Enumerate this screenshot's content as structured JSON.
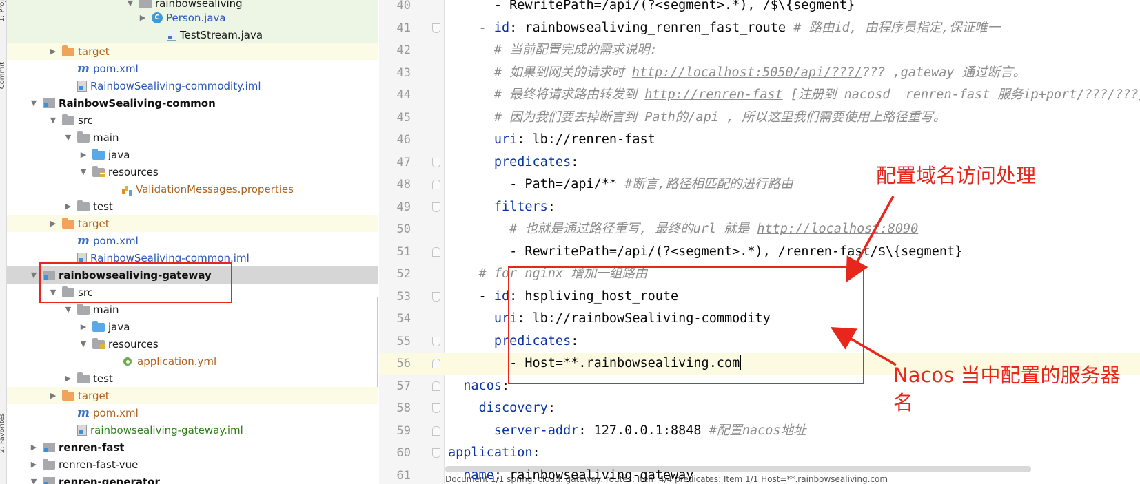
{
  "toolstrip": {
    "labels": [
      "1: Proj",
      "Commit",
      "2: Favorites"
    ]
  },
  "tree": {
    "rows": [
      {
        "label": "rainbowsealiving",
        "style": "t-black",
        "icon": "package",
        "arrow": "down",
        "hl": "hl-green"
      },
      {
        "label": "Person.java",
        "style": "t-blue",
        "icon": "class-c",
        "arrow": "right",
        "hl": "hl-green"
      },
      {
        "label": "TestStream.java",
        "style": "t-black",
        "icon": "file-java",
        "arrow": "none",
        "hl": "hl-green"
      },
      {
        "label": "target",
        "style": "t-orange",
        "icon": "folder-orange",
        "arrow": "right",
        "hl": "hl-yellow"
      },
      {
        "label": "pom.xml",
        "style": "t-blue",
        "icon": "maven",
        "arrow": "none",
        "hl": ""
      },
      {
        "label": "RainbowSealiving-commodity.iml",
        "style": "t-blue",
        "icon": "iml",
        "arrow": "none",
        "hl": ""
      },
      {
        "label": "RainbowSealiving-common",
        "style": "t-bold",
        "icon": "module",
        "arrow": "down",
        "hl": ""
      },
      {
        "label": "src",
        "style": "t-black",
        "icon": "folder",
        "arrow": "down",
        "hl": ""
      },
      {
        "label": "main",
        "style": "t-black",
        "icon": "folder",
        "arrow": "down",
        "hl": ""
      },
      {
        "label": "java",
        "style": "t-black",
        "icon": "folder-blue",
        "arrow": "right",
        "hl": ""
      },
      {
        "label": "resources",
        "style": "t-black",
        "icon": "folder-res",
        "arrow": "down",
        "hl": ""
      },
      {
        "label": "ValidationMessages.properties",
        "style": "t-orange",
        "icon": "props",
        "arrow": "none",
        "hl": ""
      },
      {
        "label": "test",
        "style": "t-black",
        "icon": "folder",
        "arrow": "right",
        "hl": ""
      },
      {
        "label": "target",
        "style": "t-orange",
        "icon": "folder-orange",
        "arrow": "right",
        "hl": "hl-yellow"
      },
      {
        "label": "pom.xml",
        "style": "t-blue",
        "icon": "maven",
        "arrow": "none",
        "hl": ""
      },
      {
        "label": "RainbowSealiving-common.iml",
        "style": "t-blue",
        "icon": "iml",
        "arrow": "none",
        "hl": ""
      },
      {
        "label": "rainbowsealiving-gateway",
        "style": "t-bold",
        "icon": "module",
        "arrow": "down",
        "hl": "hl-gray"
      },
      {
        "label": "src",
        "style": "t-black",
        "icon": "folder",
        "arrow": "down",
        "hl": ""
      },
      {
        "label": "main",
        "style": "t-black",
        "icon": "folder",
        "arrow": "down",
        "hl": ""
      },
      {
        "label": "java",
        "style": "t-black",
        "icon": "folder-blue",
        "arrow": "right",
        "hl": ""
      },
      {
        "label": "resources",
        "style": "t-black",
        "icon": "folder-res",
        "arrow": "down",
        "hl": ""
      },
      {
        "label": "application.yml",
        "style": "t-orange",
        "icon": "yml",
        "arrow": "none",
        "hl": ""
      },
      {
        "label": "test",
        "style": "t-black",
        "icon": "folder",
        "arrow": "right",
        "hl": ""
      },
      {
        "label": "target",
        "style": "t-orange",
        "icon": "folder-orange",
        "arrow": "right",
        "hl": "hl-yellow"
      },
      {
        "label": "pom.xml",
        "style": "t-orange",
        "icon": "maven",
        "arrow": "none",
        "hl": ""
      },
      {
        "label": "rainbowsealiving-gateway.iml",
        "style": "t-green",
        "icon": "iml",
        "arrow": "none",
        "hl": ""
      },
      {
        "label": "renren-fast",
        "style": "t-bold",
        "icon": "module",
        "arrow": "right",
        "hl": ""
      },
      {
        "label": "renren-fast-vue",
        "style": "t-black",
        "icon": "folder",
        "arrow": "right",
        "hl": ""
      },
      {
        "label": "renren-generator",
        "style": "t-bold",
        "icon": "module",
        "arrow": "down",
        "hl": ""
      }
    ]
  },
  "editor": {
    "lines": [
      {
        "n": "40",
        "fold": "none",
        "segs": [
          [
            "",
            "      - RewritePath=/api/(?<segment>.*), /$\\{segment}"
          ]
        ]
      },
      {
        "n": "41",
        "fold": "down",
        "segs": [
          [
            "",
            "    - "
          ],
          [
            "k",
            "id"
          ],
          [
            "",
            ": rainbowsealiving_renren_fast_route "
          ],
          [
            "cm",
            "# 路由id, 由程序员指定,保证唯一"
          ]
        ]
      },
      {
        "n": "42",
        "fold": "none",
        "segs": [
          [
            "cm",
            "      # 当前配置完成的需求说明:"
          ]
        ]
      },
      {
        "n": "43",
        "fold": "none",
        "segs": [
          [
            "cm",
            "      # 如果到网关的请求时 "
          ],
          [
            "cm u",
            "http://localhost:5050/api/???/"
          ],
          [
            "cm",
            "??? ,gateway 通过断言。"
          ]
        ]
      },
      {
        "n": "44",
        "fold": "none",
        "segs": [
          [
            "cm",
            "      # 最终将请求路由转发到 "
          ],
          [
            "cm u",
            "http://renren-fast"
          ],
          [
            "cm",
            " [注册到 nacosd  renren-fast 服务ip+port/???/???]"
          ]
        ]
      },
      {
        "n": "45",
        "fold": "none",
        "segs": [
          [
            "cm",
            "      # 因为我们要去掉断言到 Path的/api , 所以这里我们需要使用上路径重写。"
          ]
        ]
      },
      {
        "n": "46",
        "fold": "none",
        "segs": [
          [
            "",
            "      "
          ],
          [
            "k",
            "uri"
          ],
          [
            "",
            ": lb://renren-fast"
          ]
        ]
      },
      {
        "n": "47",
        "fold": "down",
        "segs": [
          [
            "",
            "      "
          ],
          [
            "k",
            "predicates"
          ],
          [
            "",
            ":"
          ]
        ]
      },
      {
        "n": "48",
        "fold": "up",
        "segs": [
          [
            "",
            "        - Path=/api/** "
          ],
          [
            "cm",
            "#断言,路径相匹配的进行路由"
          ]
        ]
      },
      {
        "n": "49",
        "fold": "down",
        "segs": [
          [
            "",
            "      "
          ],
          [
            "k",
            "filters"
          ],
          [
            "",
            ":"
          ]
        ]
      },
      {
        "n": "50",
        "fold": "none",
        "segs": [
          [
            "cm",
            "        # 也就是通过路径重写, 最终的url 就是 "
          ],
          [
            "cm u",
            "http://localhost:8090"
          ]
        ]
      },
      {
        "n": "51",
        "fold": "up",
        "segs": [
          [
            "",
            "        - RewritePath=/api/(?<segment>.*), /renren-fast/$\\{segment}"
          ]
        ]
      },
      {
        "n": "52",
        "fold": "none",
        "segs": [
          [
            "cm",
            "    # for nginx 增加一组路由"
          ]
        ]
      },
      {
        "n": "53",
        "fold": "down",
        "segs": [
          [
            "",
            "    - "
          ],
          [
            "k",
            "id"
          ],
          [
            "",
            ": hspliving_host_route"
          ]
        ]
      },
      {
        "n": "54",
        "fold": "none",
        "segs": [
          [
            "",
            "      "
          ],
          [
            "k",
            "uri"
          ],
          [
            "",
            ": lb://rainbowSealiving-commodity"
          ]
        ]
      },
      {
        "n": "55",
        "fold": "down",
        "segs": [
          [
            "",
            "      "
          ],
          [
            "k",
            "predicates"
          ],
          [
            "",
            ":"
          ]
        ]
      },
      {
        "n": "56",
        "fold": "up",
        "current": true,
        "segs": [
          [
            "",
            "        - Host=**.rainbowsealiving.com"
          ],
          [
            "caret",
            ""
          ]
        ]
      },
      {
        "n": "57",
        "fold": "up",
        "segs": [
          [
            "",
            "  "
          ],
          [
            "k",
            "nacos"
          ],
          [
            "",
            ":"
          ]
        ]
      },
      {
        "n": "58",
        "fold": "down",
        "segs": [
          [
            "",
            "    "
          ],
          [
            "k",
            "discovery"
          ],
          [
            "",
            ":"
          ]
        ]
      },
      {
        "n": "59",
        "fold": "up",
        "segs": [
          [
            "",
            "      "
          ],
          [
            "k",
            "server-addr"
          ],
          [
            "",
            ": 127.0.0.1:8848 "
          ],
          [
            "cm",
            "#配置nacos地址"
          ]
        ]
      },
      {
        "n": "60",
        "fold": "down",
        "segs": [
          [
            "k",
            "application"
          ],
          [
            "",
            ":"
          ]
        ]
      },
      {
        "n": "61",
        "fold": "none",
        "segs": [
          [
            "",
            "  "
          ],
          [
            "k",
            "name"
          ],
          [
            "",
            ": rainbowsealiving-gateway"
          ]
        ]
      }
    ],
    "status": "Document 1/1  spring:  cloud:  gateway:  routes:  Item 4/4  predicates:  Item 1/1  Host=**.rainbowsealiving.com"
  },
  "annotations": {
    "label_domain": "配置域名访问处理",
    "label_nacos_line1": "Nacos 当中配置的服务器",
    "label_nacos_line2": "名",
    "color": "#e8271c"
  }
}
